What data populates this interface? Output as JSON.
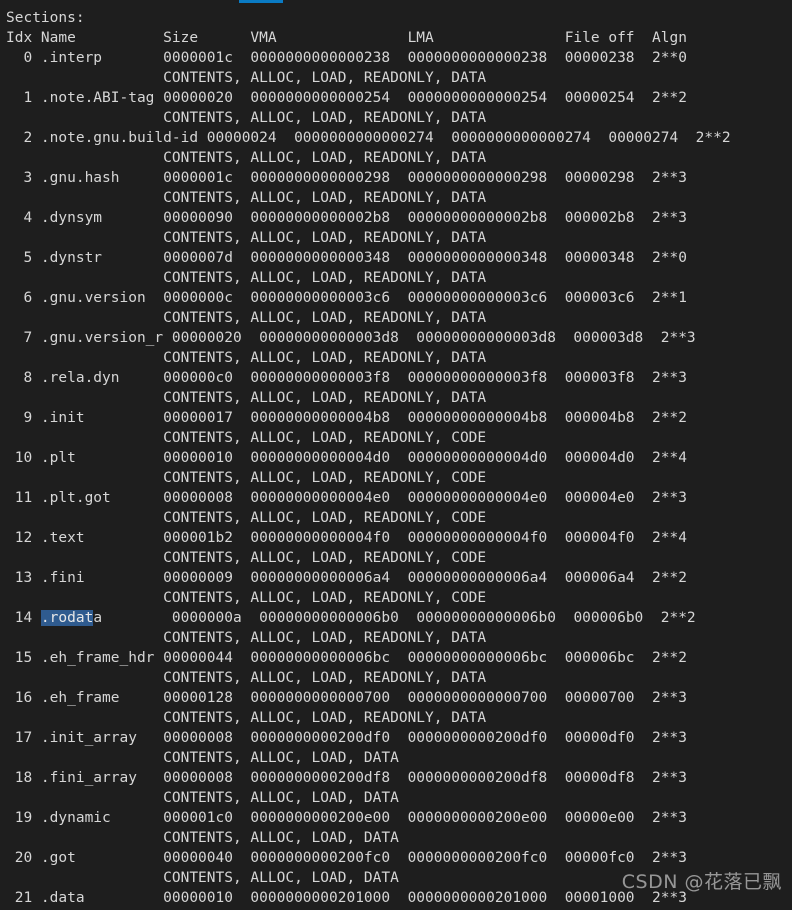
{
  "window": {
    "background_color": "#1e1e1e",
    "text_color": "#d6d6d6",
    "accent_color": "#0a7bc4",
    "selection_color": "#2f5b8f",
    "command_output_kind": "objdump-section-headers"
  },
  "output": {
    "title": "Sections:",
    "columns": {
      "idx": "Idx",
      "name": "Name",
      "size": "Size",
      "vma": "VMA",
      "lma": "LMA",
      "file_off": "File off",
      "algn": "Algn"
    },
    "header_line": "Idx Name          Size      VMA               LMA               File off  Algn"
  },
  "sections": [
    {
      "idx": "0",
      "name": ".interp",
      "size": "0000001c",
      "vma": "0000000000000238",
      "lma": "0000000000000238",
      "file_off": "00000238",
      "algn": "2**0",
      "flags": "CONTENTS, ALLOC, LOAD, READONLY, DATA",
      "line": "  0 .interp       0000001c  0000000000000238  0000000000000238  00000238  2**0",
      "flags_line": "                  CONTENTS, ALLOC, LOAD, READONLY, DATA"
    },
    {
      "idx": "1",
      "name": ".note.ABI-tag",
      "size": "00000020",
      "vma": "0000000000000254",
      "lma": "0000000000000254",
      "file_off": "00000254",
      "algn": "2**2",
      "flags": "CONTENTS, ALLOC, LOAD, READONLY, DATA",
      "line": "  1 .note.ABI-tag 00000020  0000000000000254  0000000000000254  00000254  2**2",
      "flags_line": "                  CONTENTS, ALLOC, LOAD, READONLY, DATA"
    },
    {
      "idx": "2",
      "name": ".note.gnu.build-id",
      "size": "00000024",
      "vma": "0000000000000274",
      "lma": "0000000000000274",
      "file_off": "00000274",
      "algn": "2**2",
      "flags": "CONTENTS, ALLOC, LOAD, READONLY, DATA",
      "line": "  2 .note.gnu.build-id 00000024  0000000000000274  0000000000000274  00000274  2**2",
      "flags_line": "                  CONTENTS, ALLOC, LOAD, READONLY, DATA"
    },
    {
      "idx": "3",
      "name": ".gnu.hash",
      "size": "0000001c",
      "vma": "0000000000000298",
      "lma": "0000000000000298",
      "file_off": "00000298",
      "algn": "2**3",
      "flags": "CONTENTS, ALLOC, LOAD, READONLY, DATA",
      "line": "  3 .gnu.hash     0000001c  0000000000000298  0000000000000298  00000298  2**3",
      "flags_line": "                  CONTENTS, ALLOC, LOAD, READONLY, DATA"
    },
    {
      "idx": "4",
      "name": ".dynsym",
      "size": "00000090",
      "vma": "00000000000002b8",
      "lma": "00000000000002b8",
      "file_off": "000002b8",
      "algn": "2**3",
      "flags": "CONTENTS, ALLOC, LOAD, READONLY, DATA",
      "line": "  4 .dynsym       00000090  00000000000002b8  00000000000002b8  000002b8  2**3",
      "flags_line": "                  CONTENTS, ALLOC, LOAD, READONLY, DATA"
    },
    {
      "idx": "5",
      "name": ".dynstr",
      "size": "0000007d",
      "vma": "0000000000000348",
      "lma": "0000000000000348",
      "file_off": "00000348",
      "algn": "2**0",
      "flags": "CONTENTS, ALLOC, LOAD, READONLY, DATA",
      "line": "  5 .dynstr       0000007d  0000000000000348  0000000000000348  00000348  2**0",
      "flags_line": "                  CONTENTS, ALLOC, LOAD, READONLY, DATA"
    },
    {
      "idx": "6",
      "name": ".gnu.version",
      "size": "0000000c",
      "vma": "00000000000003c6",
      "lma": "00000000000003c6",
      "file_off": "000003c6",
      "algn": "2**1",
      "flags": "CONTENTS, ALLOC, LOAD, READONLY, DATA",
      "line": "  6 .gnu.version  0000000c  00000000000003c6  00000000000003c6  000003c6  2**1",
      "flags_line": "                  CONTENTS, ALLOC, LOAD, READONLY, DATA"
    },
    {
      "idx": "7",
      "name": ".gnu.version_r",
      "size": "00000020",
      "vma": "00000000000003d8",
      "lma": "00000000000003d8",
      "file_off": "000003d8",
      "algn": "2**3",
      "flags": "CONTENTS, ALLOC, LOAD, READONLY, DATA",
      "line": "  7 .gnu.version_r 00000020  00000000000003d8  00000000000003d8  000003d8  2**3",
      "flags_line": "                  CONTENTS, ALLOC, LOAD, READONLY, DATA"
    },
    {
      "idx": "8",
      "name": ".rela.dyn",
      "size": "000000c0",
      "vma": "00000000000003f8",
      "lma": "00000000000003f8",
      "file_off": "000003f8",
      "algn": "2**3",
      "flags": "CONTENTS, ALLOC, LOAD, READONLY, DATA",
      "line": "  8 .rela.dyn     000000c0  00000000000003f8  00000000000003f8  000003f8  2**3",
      "flags_line": "                  CONTENTS, ALLOC, LOAD, READONLY, DATA"
    },
    {
      "idx": "9",
      "name": ".init",
      "size": "00000017",
      "vma": "00000000000004b8",
      "lma": "00000000000004b8",
      "file_off": "000004b8",
      "algn": "2**2",
      "flags": "CONTENTS, ALLOC, LOAD, READONLY, CODE",
      "line": "  9 .init         00000017  00000000000004b8  00000000000004b8  000004b8  2**2",
      "flags_line": "                  CONTENTS, ALLOC, LOAD, READONLY, CODE"
    },
    {
      "idx": "10",
      "name": ".plt",
      "size": "00000010",
      "vma": "00000000000004d0",
      "lma": "00000000000004d0",
      "file_off": "000004d0",
      "algn": "2**4",
      "flags": "CONTENTS, ALLOC, LOAD, READONLY, CODE",
      "line": " 10 .plt          00000010  00000000000004d0  00000000000004d0  000004d0  2**4",
      "flags_line": "                  CONTENTS, ALLOC, LOAD, READONLY, CODE"
    },
    {
      "idx": "11",
      "name": ".plt.got",
      "size": "00000008",
      "vma": "00000000000004e0",
      "lma": "00000000000004e0",
      "file_off": "000004e0",
      "algn": "2**3",
      "flags": "CONTENTS, ALLOC, LOAD, READONLY, CODE",
      "line": " 11 .plt.got      00000008  00000000000004e0  00000000000004e0  000004e0  2**3",
      "flags_line": "                  CONTENTS, ALLOC, LOAD, READONLY, CODE"
    },
    {
      "idx": "12",
      "name": ".text",
      "size": "000001b2",
      "vma": "00000000000004f0",
      "lma": "00000000000004f0",
      "file_off": "000004f0",
      "algn": "2**4",
      "flags": "CONTENTS, ALLOC, LOAD, READONLY, CODE",
      "line": " 12 .text         000001b2  00000000000004f0  00000000000004f0  000004f0  2**4",
      "flags_line": "                  CONTENTS, ALLOC, LOAD, READONLY, CODE"
    },
    {
      "idx": "13",
      "name": ".fini",
      "size": "00000009",
      "vma": "00000000000006a4",
      "lma": "00000000000006a4",
      "file_off": "000006a4",
      "algn": "2**2",
      "flags": "CONTENTS, ALLOC, LOAD, READONLY, CODE",
      "line": " 13 .fini         00000009  00000000000006a4  00000000000006a4  000006a4  2**2",
      "flags_line": "                  CONTENTS, ALLOC, LOAD, READONLY, CODE"
    },
    {
      "idx": "14",
      "name": ".rodata",
      "size": "0000000a",
      "vma": "00000000000006b0",
      "lma": "00000000000006b0",
      "file_off": "000006b0",
      "algn": "2**2",
      "flags": "CONTENTS, ALLOC, LOAD, READONLY, DATA",
      "selected": true,
      "selection_text": ".rodat",
      "line_prefix": " 14 ",
      "line_selected": ".rodat",
      "line_suffix": "a        0000000a  00000000000006b0  00000000000006b0  000006b0  2**2",
      "flags_line": "                  CONTENTS, ALLOC, LOAD, READONLY, DATA"
    },
    {
      "idx": "15",
      "name": ".eh_frame_hdr",
      "size": "00000044",
      "vma": "00000000000006bc",
      "lma": "00000000000006bc",
      "file_off": "000006bc",
      "algn": "2**2",
      "flags": "CONTENTS, ALLOC, LOAD, READONLY, DATA",
      "line": " 15 .eh_frame_hdr 00000044  00000000000006bc  00000000000006bc  000006bc  2**2",
      "flags_line": "                  CONTENTS, ALLOC, LOAD, READONLY, DATA"
    },
    {
      "idx": "16",
      "name": ".eh_frame",
      "size": "00000128",
      "vma": "0000000000000700",
      "lma": "0000000000000700",
      "file_off": "00000700",
      "algn": "2**3",
      "flags": "CONTENTS, ALLOC, LOAD, READONLY, DATA",
      "line": " 16 .eh_frame     00000128  0000000000000700  0000000000000700  00000700  2**3",
      "flags_line": "                  CONTENTS, ALLOC, LOAD, READONLY, DATA"
    },
    {
      "idx": "17",
      "name": ".init_array",
      "size": "00000008",
      "vma": "0000000000200df0",
      "lma": "0000000000200df0",
      "file_off": "00000df0",
      "algn": "2**3",
      "flags": "CONTENTS, ALLOC, LOAD, DATA",
      "line": " 17 .init_array   00000008  0000000000200df0  0000000000200df0  00000df0  2**3",
      "flags_line": "                  CONTENTS, ALLOC, LOAD, DATA"
    },
    {
      "idx": "18",
      "name": ".fini_array",
      "size": "00000008",
      "vma": "0000000000200df8",
      "lma": "0000000000200df8",
      "file_off": "00000df8",
      "algn": "2**3",
      "flags": "CONTENTS, ALLOC, LOAD, DATA",
      "line": " 18 .fini_array   00000008  0000000000200df8  0000000000200df8  00000df8  2**3",
      "flags_line": "                  CONTENTS, ALLOC, LOAD, DATA"
    },
    {
      "idx": "19",
      "name": ".dynamic",
      "size": "000001c0",
      "vma": "0000000000200e00",
      "lma": "0000000000200e00",
      "file_off": "00000e00",
      "algn": "2**3",
      "flags": "CONTENTS, ALLOC, LOAD, DATA",
      "line": " 19 .dynamic      000001c0  0000000000200e00  0000000000200e00  00000e00  2**3",
      "flags_line": "                  CONTENTS, ALLOC, LOAD, DATA"
    },
    {
      "idx": "20",
      "name": ".got",
      "size": "00000040",
      "vma": "0000000000200fc0",
      "lma": "0000000000200fc0",
      "file_off": "00000fc0",
      "algn": "2**3",
      "flags": "CONTENTS, ALLOC, LOAD, DATA",
      "line": " 20 .got          00000040  0000000000200fc0  0000000000200fc0  00000fc0  2**3",
      "flags_line": "                  CONTENTS, ALLOC, LOAD, DATA"
    },
    {
      "idx": "21",
      "name": ".data",
      "size": "00000010",
      "vma": "0000000000201000",
      "lma": "0000000000201000",
      "file_off": "00001000",
      "algn": "2**3",
      "flags": "",
      "line": " 21 .data         00000010  0000000000201000  0000000000201000  00001000  2**3",
      "flags_line": ""
    }
  ],
  "watermark": {
    "text": "CSDN @花落已飘"
  }
}
